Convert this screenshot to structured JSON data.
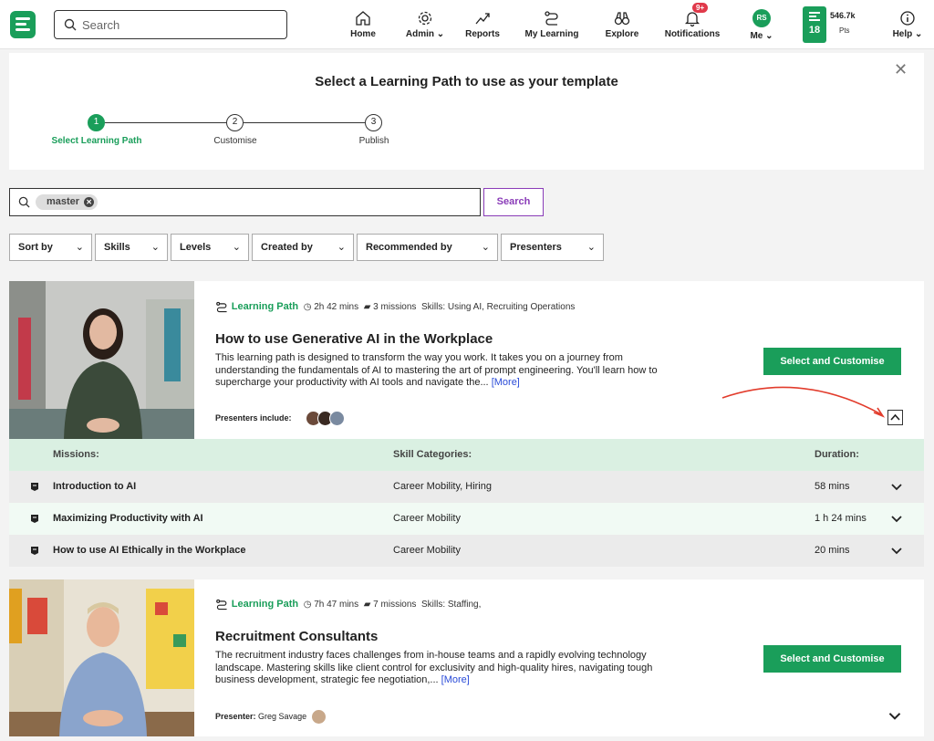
{
  "nav": {
    "search_placeholder": "Search",
    "items": [
      {
        "label": "Home",
        "icon": "home-icon"
      },
      {
        "label": "Admin",
        "icon": "gear-icon"
      },
      {
        "label": "Reports",
        "icon": "trend-icon"
      },
      {
        "label": "My Learning",
        "icon": "path-icon"
      },
      {
        "label": "Explore",
        "icon": "binoculars-icon"
      },
      {
        "label": "Notifications",
        "icon": "bell-icon"
      },
      {
        "label": "Me",
        "icon": "avatar"
      },
      {
        "label": "Help",
        "icon": "info-icon"
      }
    ],
    "notifications_badge": "9+",
    "me_initials": "RS",
    "streak": "18",
    "points_value": "546.7k",
    "points_label": "Pts"
  },
  "panel": {
    "title": "Select a Learning Path to use as your template",
    "steps": [
      {
        "number": "1",
        "label": "Select Learning Path",
        "active": true
      },
      {
        "number": "2",
        "label": "Customise",
        "active": false
      },
      {
        "number": "3",
        "label": "Publish",
        "active": false
      }
    ]
  },
  "search": {
    "chip": "master",
    "button": "Search"
  },
  "filters": [
    "Sort by",
    "Skills",
    "Levels",
    "Created by",
    "Recommended by",
    "Presenters"
  ],
  "cards": [
    {
      "type": "Learning Path",
      "duration": "2h 42 mins",
      "missions": "3 missions",
      "skills": "Skills: Using AI, Recruiting Operations",
      "title": "How to use Generative AI in the Workplace",
      "description": "This learning path is designed to transform the way you work. It takes you on a journey from understanding the fundamentals of AI to mastering the art of prompt engineering. You'll learn how to supercharge your productivity with AI tools and navigate the...",
      "more": "[More]",
      "presenters_label": "Presenters include:",
      "button": "Select and Customise"
    },
    {
      "type": "Learning Path",
      "duration": "7h 47 mins",
      "missions": "7 missions",
      "skills": "Skills: Staffing,",
      "title": "Recruitment Consultants",
      "description": "The recruitment industry faces challenges from in-house teams and a rapidly evolving technology landscape. Mastering skills like client control for exclusivity and high-quality hires, navigating tough business development, strategic fee negotiation,...",
      "more": "[More]",
      "presenters_label": "Presenter:",
      "presenter_name": "Greg Savage",
      "button": "Select and Customise"
    }
  ],
  "missions_table": {
    "headers": {
      "missions": "Missions:",
      "skills": "Skill Categories:",
      "duration": "Duration:"
    },
    "rows": [
      {
        "title": "Introduction to AI",
        "skills": "Career Mobility, Hiring",
        "duration": "58 mins"
      },
      {
        "title": "Maximizing Productivity with AI",
        "skills": "Career Mobility",
        "duration": "1 h 24 mins"
      },
      {
        "title": "How to use AI Ethically in the Workplace",
        "skills": "Career Mobility",
        "duration": "20 mins"
      }
    ]
  },
  "colors": {
    "brand_green": "#1a9e5a",
    "accent_purple": "#8a3cb8",
    "annotation_red": "#e23c2c",
    "link_blue": "#2a4bd8"
  }
}
